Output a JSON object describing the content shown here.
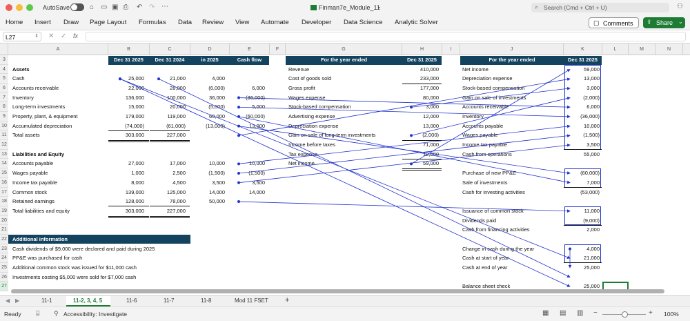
{
  "window": {
    "autosave": "AutoSave",
    "filename": "Finman7e_Module_11",
    "search": "Search (Cmd + Ctrl + U)"
  },
  "ribbon": {
    "tabs": [
      "Home",
      "Insert",
      "Draw",
      "Page Layout",
      "Formulas",
      "Data",
      "Review",
      "View",
      "Automate",
      "Developer",
      "Data Science",
      "Analytic Solver"
    ],
    "comments": "Comments",
    "share": "Share"
  },
  "formula_bar": {
    "cell_ref": "L27",
    "fx": "fx"
  },
  "columns": [
    "A",
    "B",
    "C",
    "D",
    "E",
    "F",
    "G",
    "H",
    "I",
    "J",
    "K",
    "L",
    "M",
    "N"
  ],
  "rows": [
    "3",
    "4",
    "5",
    "6",
    "7",
    "8",
    "9",
    "10",
    "11",
    "12",
    "13",
    "14",
    "15",
    "16",
    "17",
    "18",
    "19",
    "20",
    "21",
    "22",
    "23",
    "24",
    "25",
    "26",
    "27"
  ],
  "balance": {
    "headers": [
      "Dec 31 2025",
      "Dec 31 2024",
      "in 2025",
      "Cash flow"
    ],
    "lines": [
      {
        "label": "Assets",
        "bold": true
      },
      {
        "label": "Cash",
        "v": [
          "25,000",
          "21,000",
          "4,000",
          ""
        ]
      },
      {
        "label": "Accounts receivable",
        "v": [
          "22,000",
          "28,000",
          "(6,000)",
          "6,000"
        ]
      },
      {
        "label": "Inventory",
        "v": [
          "136,000",
          "100,000",
          "36,000",
          "(36,000)"
        ]
      },
      {
        "label": "Long-term investments",
        "v": [
          "15,000",
          "20,000",
          "(5,000)",
          "5,000"
        ]
      },
      {
        "label": "Property, plant, & equipment",
        "v": [
          "179,000",
          "119,000",
          "60,000",
          "(60,000)"
        ]
      },
      {
        "label": "Accumulated depreciation",
        "v": [
          "(74,000)",
          "(61,000)",
          "(13,000)",
          "13,000"
        ]
      },
      {
        "label": "Total assets",
        "v": [
          "303,000",
          "227,000",
          "",
          ""
        ]
      },
      {
        "label": "",
        "v": [
          "",
          "",
          "",
          ""
        ]
      },
      {
        "label": "Liabilities and Equity",
        "bold": true
      },
      {
        "label": "Accounts payable",
        "v": [
          "27,000",
          "17,000",
          "10,000",
          "10,000"
        ]
      },
      {
        "label": "Wages payable",
        "v": [
          "1,000",
          "2,500",
          "(1,500)",
          "(1,500)"
        ]
      },
      {
        "label": "Income tax payable",
        "v": [
          "8,000",
          "4,500",
          "3,500",
          "3,500"
        ]
      },
      {
        "label": "Common stock",
        "v": [
          "139,000",
          "125,000",
          "14,000",
          "14,000"
        ]
      },
      {
        "label": "Retained earnings",
        "v": [
          "128,000",
          "78,000",
          "50,000",
          ""
        ]
      },
      {
        "label": "Total liabilities and equity",
        "v": [
          "303,000",
          "227,000",
          "",
          ""
        ]
      }
    ]
  },
  "income": {
    "header": "For the year ended",
    "col": "Dec 31 2025",
    "lines": [
      {
        "label": "Revenue",
        "v": "410,000"
      },
      {
        "label": "Cost of goods sold",
        "v": "233,000"
      },
      {
        "label": "Gross profit",
        "v": "177,000"
      },
      {
        "label": "Wages expense",
        "v": "80,000"
      },
      {
        "label": "Stock-based compensation",
        "v": "3,000"
      },
      {
        "label": "Advertising expense",
        "v": "12,000"
      },
      {
        "label": "Depreciation expense",
        "v": "13,000"
      },
      {
        "label": "Gain on sale of long-term investments",
        "v": "(2,000)"
      },
      {
        "label": "Income before taxes",
        "v": "71,000"
      },
      {
        "label": "Tax expense",
        "v": "12,000"
      },
      {
        "label": "Net income",
        "v": "59,000"
      }
    ]
  },
  "cashflow": {
    "header": "For the year ended",
    "col": "Dec 31 2025",
    "lines": [
      {
        "label": "Net income",
        "v": "59,000"
      },
      {
        "label": "Depreciation expense",
        "v": "13,000"
      },
      {
        "label": "Stock-based compensation",
        "v": "3,000"
      },
      {
        "label": "Gain on sale of investments",
        "v": "(2,000)"
      },
      {
        "label": "Accounts receivable",
        "v": "6,000"
      },
      {
        "label": "Inventory",
        "v": "(36,000)"
      },
      {
        "label": "Accounts payable",
        "v": "10,000"
      },
      {
        "label": "Wages payable",
        "v": "(1,500)"
      },
      {
        "label": "Income tax payable",
        "v": "3,500"
      },
      {
        "label": "Cash from operations",
        "v": "55,000"
      },
      {
        "label": "",
        "v": ""
      },
      {
        "label": "Purchase of new PP&E",
        "v": "(60,000)"
      },
      {
        "label": "Sale of investments",
        "v": "7,000"
      },
      {
        "label": "Cash for investing activities",
        "v": "(53,000)"
      },
      {
        "label": "",
        "v": ""
      },
      {
        "label": "Issuance of common stock",
        "v": "11,000"
      },
      {
        "label": "Dividends paid",
        "v": "(9,000)"
      },
      {
        "label": "Cash from financing activities",
        "v": "2,000"
      },
      {
        "label": "",
        "v": ""
      },
      {
        "label": "Change in cash during the year",
        "v": "4,000"
      },
      {
        "label": "Cash at start of year",
        "v": "21,000"
      },
      {
        "label": "Cash at end of year",
        "v": "25,000"
      },
      {
        "label": "",
        "v": ""
      },
      {
        "label": "Balance sheet check",
        "v": "25,000"
      }
    ]
  },
  "additional": {
    "header": "Additional information",
    "notes": [
      "Cash dividends of $9,000 were declared and paid during 2025",
      "PP&E was purchased for cash",
      "Additional common stock was issued for $11,000 cash",
      "Investments costing $5,000 were sold for $7,000 cash"
    ]
  },
  "sheets": [
    "11-1",
    "11-2, 3, 4, 5",
    "11-6",
    "11-7",
    "11-8",
    "Mod 11 FSET"
  ],
  "status": {
    "ready": "Ready",
    "accessibility": "Accessibility: Investigate",
    "zoom": "100%"
  },
  "colors": {
    "header_fill": "#14435f",
    "arrow": "#2233cc",
    "share": "#1e7b34"
  }
}
